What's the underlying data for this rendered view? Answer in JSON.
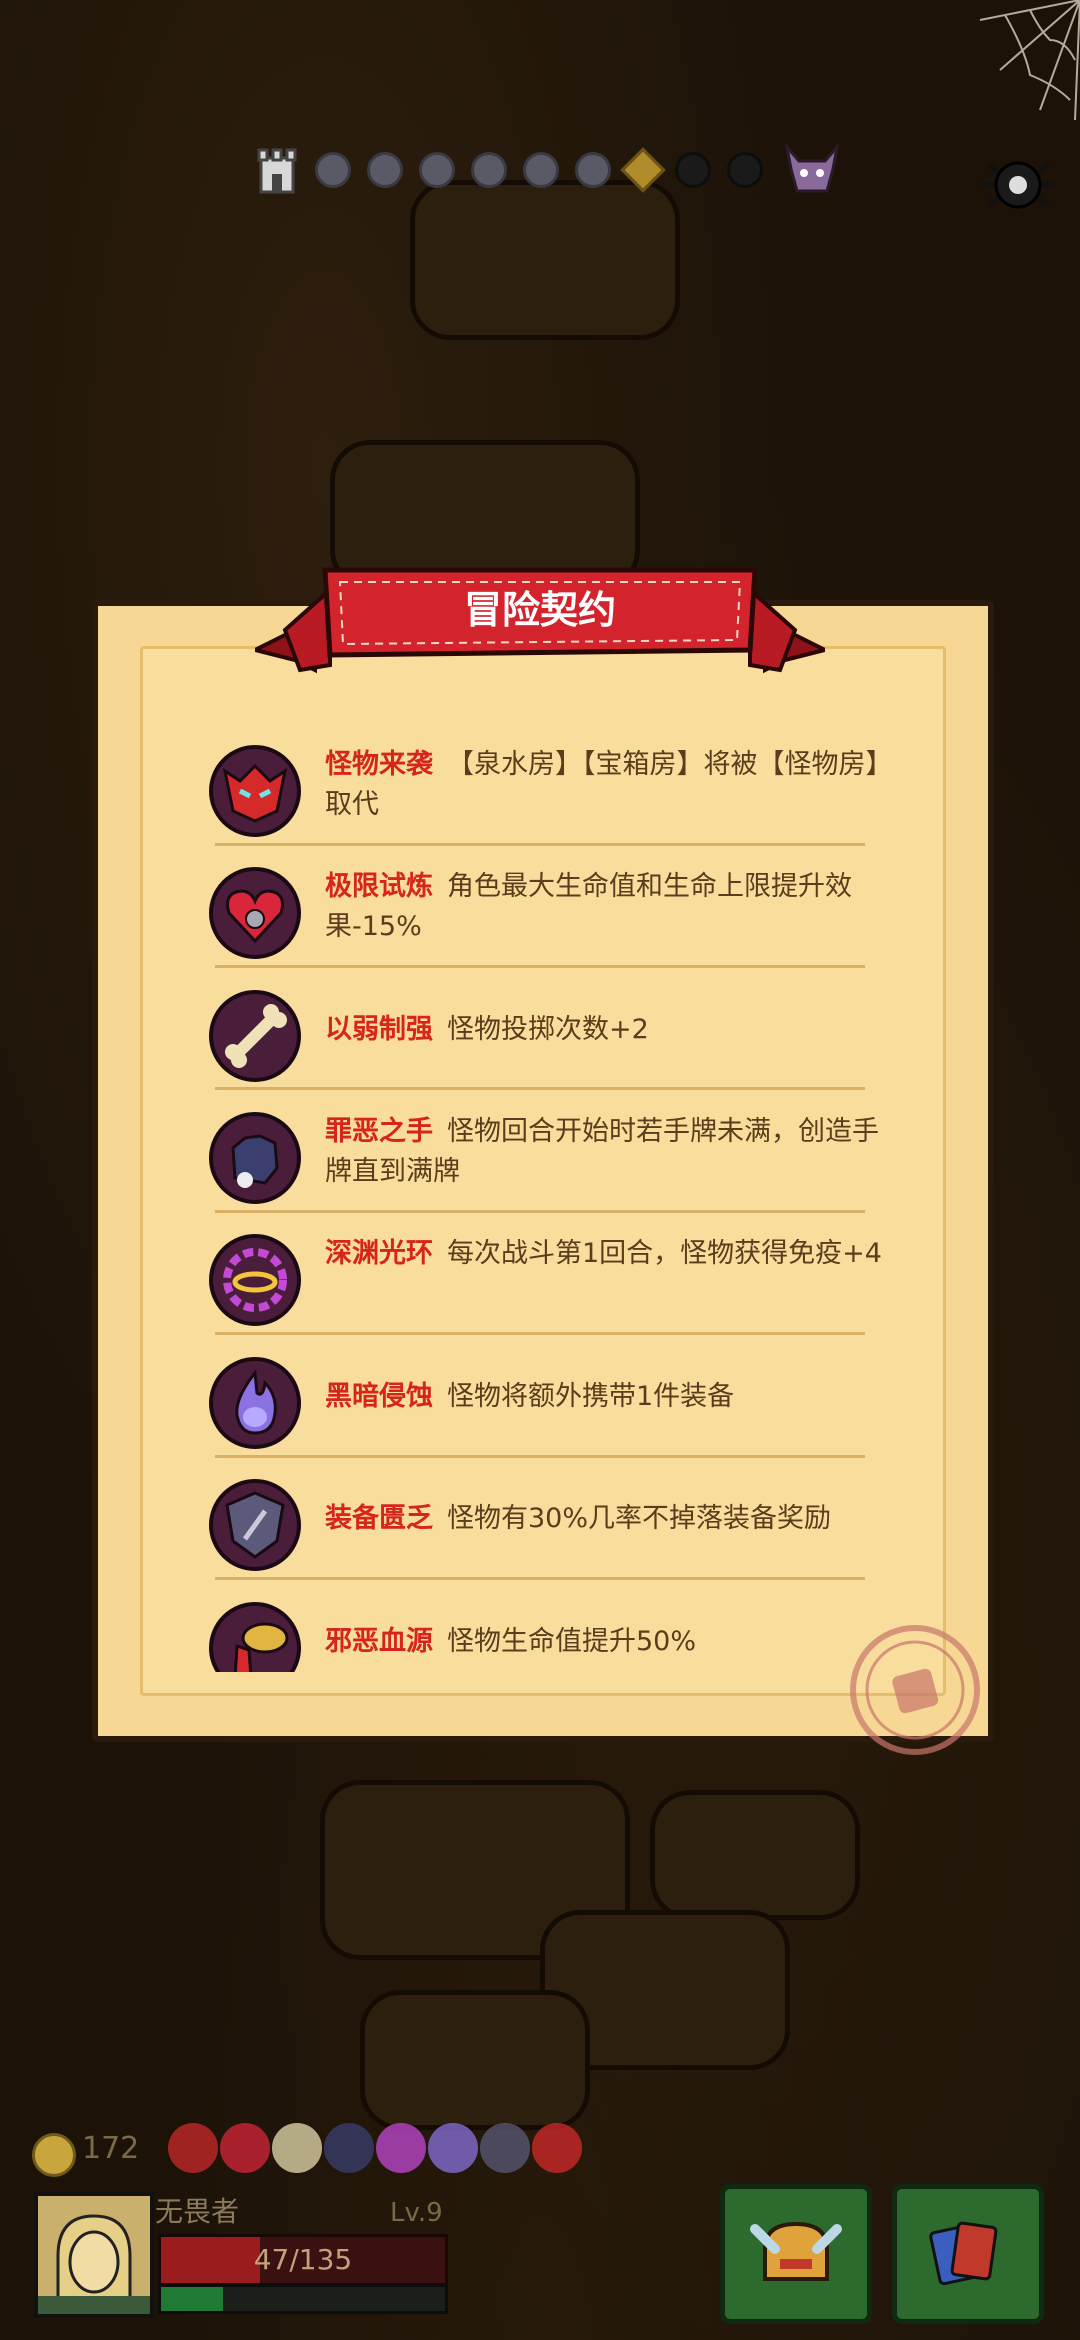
{
  "banner": {
    "title": "冒险契约"
  },
  "contracts": [
    {
      "name": "怪物来袭",
      "desc": "【泉水房】【宝箱房】将被【怪物房】取代",
      "icon": "demon-face-icon"
    },
    {
      "name": "极限试炼",
      "desc": "角色最大生命值和生命上限提升效果-15%",
      "icon": "locked-heart-icon"
    },
    {
      "name": "以弱制强",
      "desc": "怪物投掷次数+2",
      "icon": "bone-icon"
    },
    {
      "name": "罪恶之手",
      "desc": "怪物回合开始时若手牌未满，创造手牌直到满牌",
      "icon": "dark-hand-icon"
    },
    {
      "name": "深渊光环",
      "desc": "每次战斗第1回合，怪物获得免疫+4",
      "icon": "halo-icon"
    },
    {
      "name": "黑暗侵蚀",
      "desc": "怪物将额外携带1件装备",
      "icon": "dark-flame-icon"
    },
    {
      "name": "装备匮乏",
      "desc": "怪物有30%几率不掉落装备奖励",
      "icon": "sword-shield-icon"
    },
    {
      "name": "邪恶血源",
      "desc": "怪物生命值提升50%",
      "icon": "blood-source-icon"
    }
  ],
  "hud": {
    "coins": "172",
    "hero_name": "无畏者",
    "level": "Lv.9",
    "hp_text": "47/135",
    "hp_fraction": 0.348,
    "xp_fraction": 0.22
  },
  "progress": {
    "nodes": [
      "castle-icon",
      "dot",
      "dot",
      "dot",
      "dot",
      "dot",
      "dot",
      "current-diamond",
      "dot-dark",
      "dot-dark",
      "boss-icon"
    ]
  },
  "colors": {
    "title_red": "#d6251c",
    "text_brown": "#5b3c1c",
    "parchment": "#f6d894",
    "banner_red": "#c9212a"
  }
}
